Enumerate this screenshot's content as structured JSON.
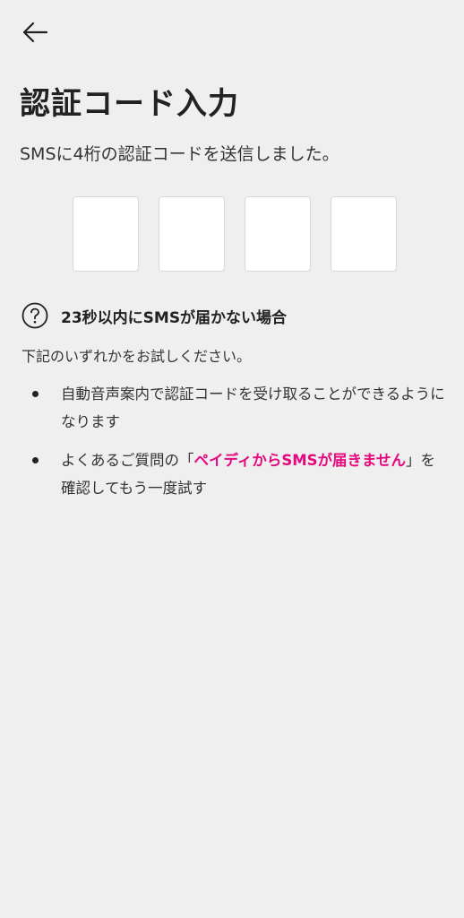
{
  "header": {
    "back_icon": "arrow-left-icon"
  },
  "page": {
    "title": "認証コード入力",
    "subtitle": "SMSに4桁の認証コードを送信しました。"
  },
  "code_inputs": {
    "count": 4,
    "values": [
      "",
      "",
      "",
      ""
    ]
  },
  "help": {
    "icon": "question-circle-icon",
    "title": "23秒以内にSMSが届かない場合",
    "description": "下記のいずれかをお試しください。",
    "items": [
      {
        "text": "自動音声案内で認証コードを受け取ることができるようになります"
      },
      {
        "prefix": "よくあるご質問の「",
        "link": "ペイディからSMSが届きません",
        "suffix": "」を確認してもう一度試す"
      }
    ]
  },
  "colors": {
    "background": "#efefef",
    "link": "#e5097f",
    "text": "#222222"
  }
}
